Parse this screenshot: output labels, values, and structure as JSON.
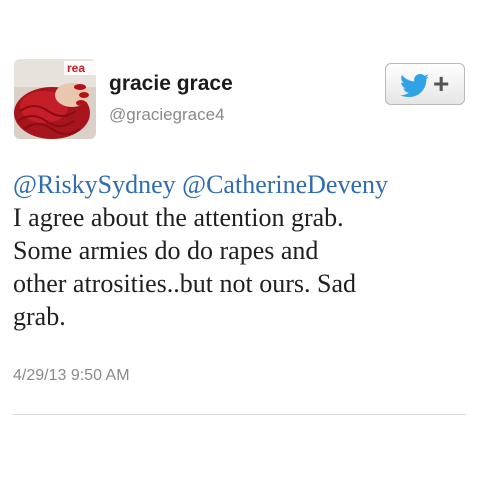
{
  "user": {
    "display_name": "gracie grace",
    "handle": "@graciegrace4",
    "avatar_icon": "knitted-red-sleeve-avatar",
    "avatar_badge_text": "rea"
  },
  "follow_button": {
    "icon": "twitter-bird-icon",
    "plus_label": "+",
    "accent_color": "#2fa3e6"
  },
  "tweet": {
    "mentions": [
      "@RiskySydney",
      "@CatherineDeveny"
    ],
    "lines": [
      "I agree about the attention grab.",
      "Some armies do do rapes and",
      "other atrosities..but not ours. Sad",
      "grab."
    ],
    "timestamp": "4/29/13 9:50 AM",
    "mention_color": "#2f6db0"
  }
}
